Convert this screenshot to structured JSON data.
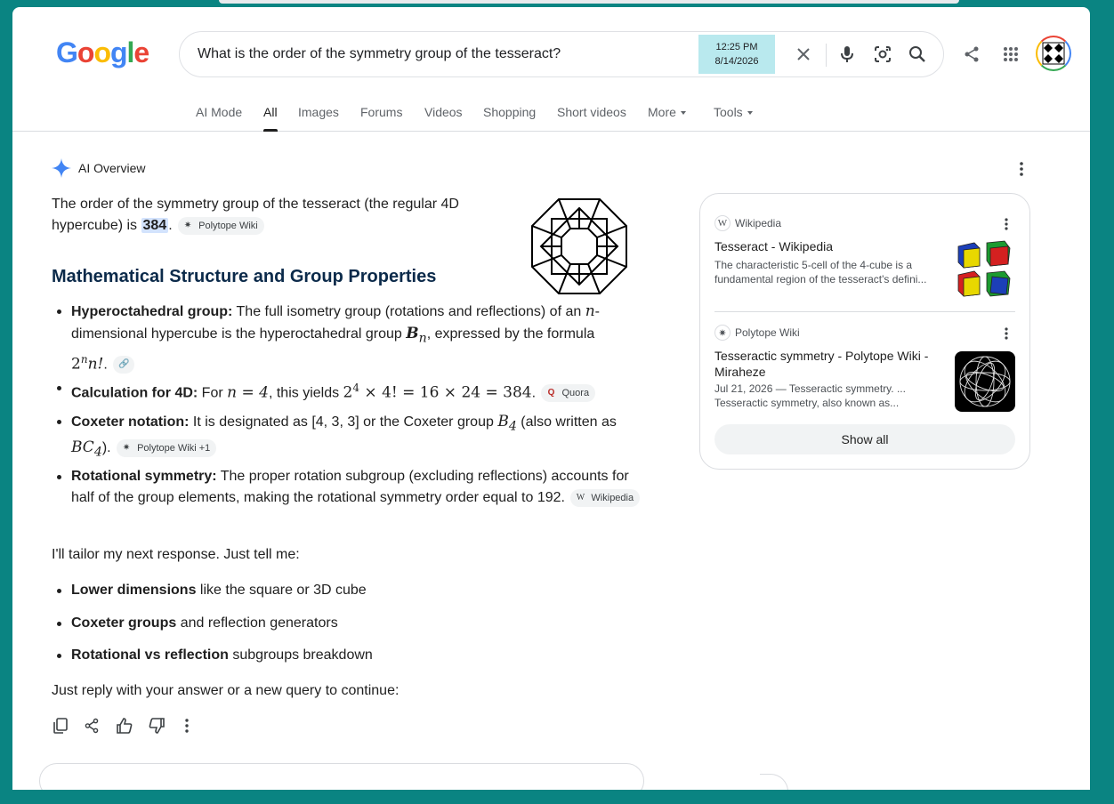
{
  "header": {
    "logo": [
      "G",
      "o",
      "o",
      "g",
      "l",
      "e"
    ],
    "logo_colors": [
      "#4285f4",
      "#ea4335",
      "#fbbc05",
      "#4285f4",
      "#34a853",
      "#ea4335"
    ],
    "search_query": "What is the order of the symmetry group of the tesseract?",
    "clock_time": "12:25 PM",
    "clock_date": "8/14/2026"
  },
  "nav": {
    "tabs": [
      "AI Mode",
      "All",
      "Images",
      "Forums",
      "Videos",
      "Shopping",
      "Short videos",
      "More",
      "Tools"
    ],
    "active": "All"
  },
  "ai_overview": {
    "title": "AI Overview",
    "intro_1": "The order of the symmetry group of the tesseract (the regular 4D hypercube) is ",
    "intro_value": "384",
    "intro_end": ".",
    "intro_chip": "Polytope Wiki",
    "heading": "Mathematical Structure and Group Properties",
    "bullets": [
      {
        "bold": "Hyperoctahedral group:",
        "text_a": " The full isometry group (rotations and reflections) of an ",
        "math_n": "n",
        "text_b": "-dimensional hypercube is the hyperoctahedral group ",
        "math_b": "B",
        "math_b_sub": "n",
        "text_c": ", expressed by the formula ",
        "formula": "2",
        "formula_sup": "n",
        "formula_end": "n!",
        "text_d": ". "
      },
      {
        "bold": "Calculation for 4D:",
        "text_a": " For ",
        "math_a": "n = 4",
        "text_b": ", this yields ",
        "formula_base": "2",
        "formula_sup": "4",
        "formula_rest": " × 4! = 16 × 24 = 384",
        "text_c": ". ",
        "chip": "Quora"
      },
      {
        "bold": "Coxeter notation:",
        "text_a": " It is designated as [4, 3, 3] or the Coxeter group ",
        "math_b": "B",
        "math_b_sub": "4",
        "text_b": " (also written as ",
        "math_bc": "BC",
        "math_bc_sub": "4",
        "text_c": "). ",
        "chip": "Polytope Wiki +1"
      },
      {
        "bold": "Rotational symmetry:",
        "text_a": " The proper rotation subgroup (excluding reflections) accounts for half of the group elements, making the rotational symmetry order equal to 192. ",
        "chip": "Wikipedia"
      }
    ],
    "tailor": "I'll tailor my next response. Just tell me:",
    "options": [
      {
        "bold": "Lower dimensions",
        "text": " like the square or 3D cube"
      },
      {
        "bold": "Coxeter groups",
        "text": " and reflection generators"
      },
      {
        "bold": "Rotational vs reflection",
        "text": " subgroups breakdown"
      }
    ],
    "closing": "Just reply with your answer or a new query to continue:"
  },
  "sources": [
    {
      "site": "Wikipedia",
      "title": "Tesseract - Wikipedia",
      "snippet": "The characteristic 5-cell of the 4-cube is a fundamental region of the tesseract's defini..."
    },
    {
      "site": "Polytope Wiki",
      "title": "Tesseractic symmetry - Polytope Wiki - Miraheze",
      "snippet": "Jul 21, 2026 — Tesseractic symmetry. ... Tesseractic symmetry, also known as..."
    }
  ],
  "show_all": "Show all"
}
